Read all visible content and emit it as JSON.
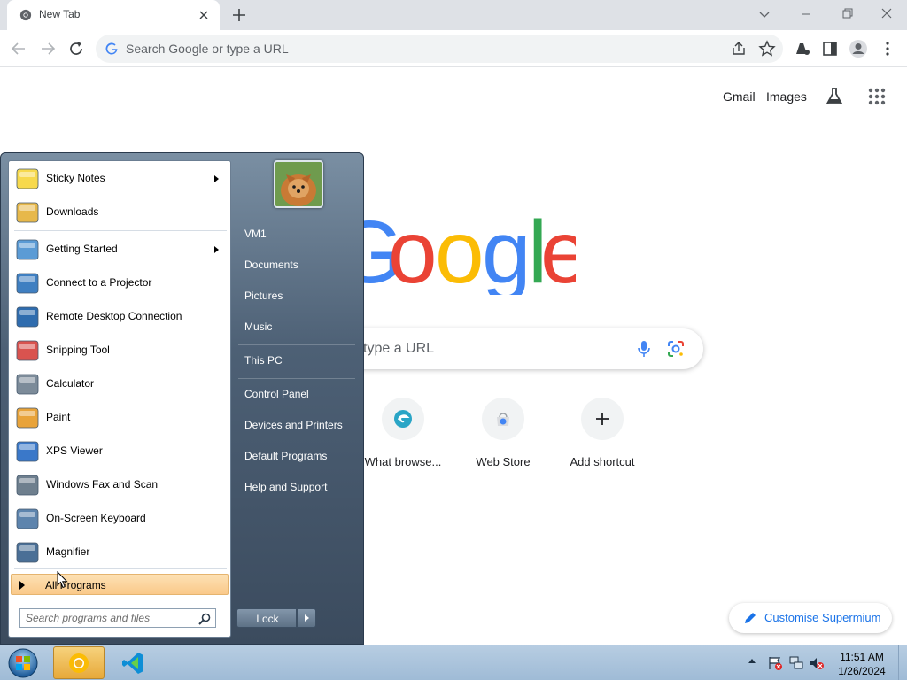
{
  "browser": {
    "tab": {
      "title": "New Tab",
      "favicon": "chrome-icon"
    },
    "omnibox": {
      "placeholder": "Search Google or type a URL"
    },
    "toolbar_icons": [
      "back-icon",
      "forward-icon",
      "reload-icon",
      "share-icon",
      "bookmark-star-icon",
      "extensions-icon",
      "side-panel-icon",
      "profile-icon",
      "menu-kebab-icon"
    ]
  },
  "ntp": {
    "top_links": {
      "gmail": "Gmail",
      "images": "Images"
    },
    "search_box": {
      "text": "type a URL"
    },
    "shortcuts": [
      {
        "label": "What browse...",
        "icon": "browser-icon"
      },
      {
        "label": "Web Store",
        "icon": "web-store-icon"
      },
      {
        "label": "Add shortcut",
        "icon": "plus-icon"
      }
    ],
    "customise": {
      "label": "Customise Supermium"
    },
    "colors": {
      "blue": "#4285F4",
      "red": "#EA4335",
      "yellow": "#FBBC05",
      "green": "#34A853",
      "accent": "#1A73E8"
    }
  },
  "start_menu": {
    "programs": [
      {
        "label": "Sticky Notes",
        "icon": "sticky-notes-icon",
        "submenu": true
      },
      {
        "label": "Downloads",
        "icon": "downloads-folder-icon",
        "submenu": false
      },
      {
        "label": "Getting Started",
        "icon": "getting-started-icon",
        "submenu": true
      },
      {
        "label": "Connect to a Projector",
        "icon": "projector-icon",
        "submenu": false
      },
      {
        "label": "Remote Desktop Connection",
        "icon": "remote-desktop-icon",
        "submenu": false
      },
      {
        "label": "Snipping Tool",
        "icon": "scissors-icon",
        "submenu": false
      },
      {
        "label": "Calculator",
        "icon": "calculator-icon",
        "submenu": false
      },
      {
        "label": "Paint",
        "icon": "paint-palette-icon",
        "submenu": false
      },
      {
        "label": "XPS Viewer",
        "icon": "xps-viewer-icon",
        "submenu": false
      },
      {
        "label": "Windows Fax and Scan",
        "icon": "fax-icon",
        "submenu": false
      },
      {
        "label": "On-Screen Keyboard",
        "icon": "keyboard-icon",
        "submenu": false
      },
      {
        "label": "Magnifier",
        "icon": "magnifier-icon",
        "submenu": false
      }
    ],
    "all_programs": "All Programs",
    "search": {
      "placeholder": "Search programs and files"
    },
    "right_items": [
      "VM1",
      "Documents",
      "Pictures",
      "Music",
      "This PC",
      "Control Panel",
      "Devices and Printers",
      "Default Programs",
      "Help and Support"
    ],
    "lock_label": "Lock"
  },
  "taskbar": {
    "pinned": [
      "start-orb-icon",
      "chrome-icon",
      "vscode-icon"
    ],
    "tray_icons": [
      "action-center-icon",
      "network-icon",
      "volume-muted-icon"
    ],
    "clock": {
      "time": "11:51 AM",
      "date": "1/26/2024"
    }
  }
}
